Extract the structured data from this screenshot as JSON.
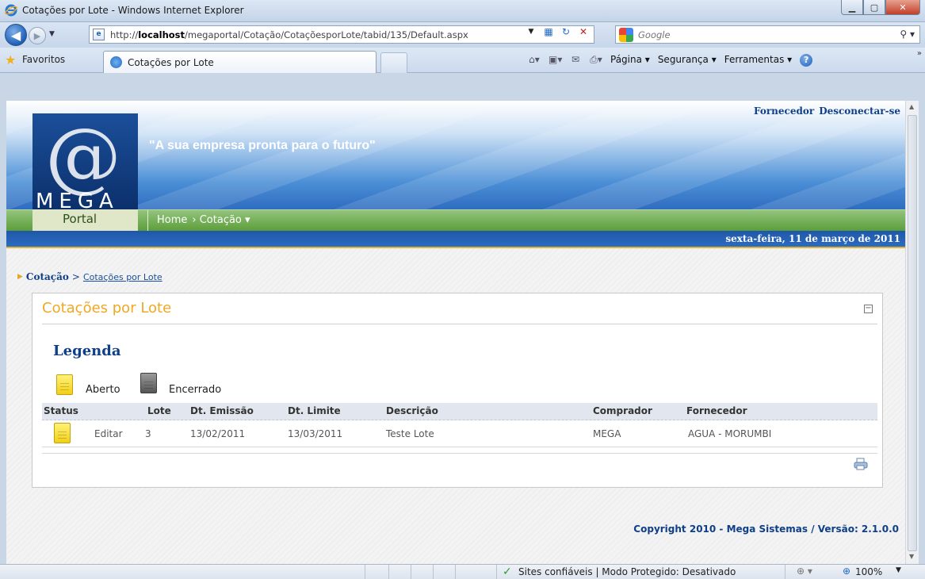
{
  "window": {
    "title": "Cotações por Lote - Windows Internet Explorer"
  },
  "browser": {
    "url_prefix": "http://",
    "url_host": "localhost",
    "url_path": "/megaportal/Cotação/CotaçõesporLote/tabid/135/Default.aspx",
    "search_placeholder": "Google",
    "favorites_label": "Favoritos",
    "tab_label": "Cotações por Lote",
    "commands": [
      "Página ▾",
      "Segurança ▾",
      "Ferramentas ▾"
    ]
  },
  "header": {
    "user_link": "Fornecedor",
    "logout_link": "Desconectar-se",
    "slogan": "\"A sua empresa pronta para o futuro\"",
    "logo_text": "MEGA",
    "logo_subtext": "Portal"
  },
  "menu": {
    "home": "Home",
    "cotacao": "› Cotação ▾"
  },
  "date_text": "sexta-feira, 11 de março de 2011",
  "breadcrumb": {
    "root": "Cotação",
    "separator": ">",
    "current": "Cotações por Lote"
  },
  "panel": {
    "title": "Cotações por Lote",
    "legend_title": "Legenda",
    "legend": [
      {
        "label": "Aberto",
        "color": "#f2cf15"
      },
      {
        "label": "Encerrado",
        "color": "#555555"
      }
    ],
    "columns": [
      "Status",
      "Lote",
      "Dt. Emissão",
      "Dt. Limite",
      "Descrição",
      "Comprador",
      "Fornecedor"
    ],
    "rows": [
      {
        "action": "Editar",
        "lote": "3",
        "emissao": "13/02/2011",
        "limite": "13/03/2011",
        "descricao": "Teste Lote",
        "comprador": "MEGA",
        "fornecedor": "AGUA - MORUMBI"
      }
    ]
  },
  "footer": {
    "copyright": "Copyright 2010 - Mega Sistemas / Versão: 2.1.0.0"
  },
  "statusbar": {
    "text": "Sites confiáveis | Modo Protegido: Desativado",
    "zoom": "100%"
  },
  "colors": {
    "accent_orange": "#f0a824",
    "brand_blue": "#0f3f88",
    "menu_green": "#5c9e3a"
  }
}
